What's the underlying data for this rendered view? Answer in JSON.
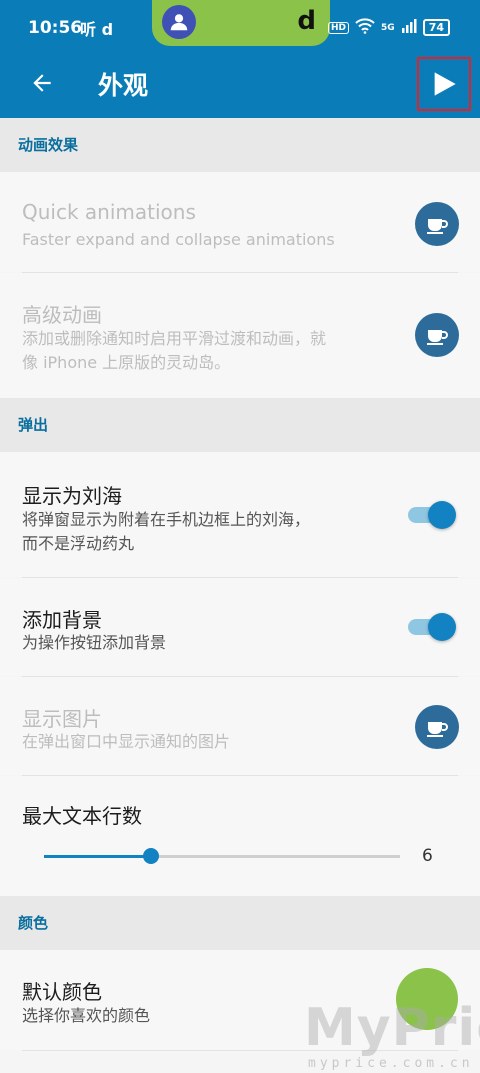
{
  "status_bar": {
    "time": "10:56",
    "left_icons": "听 d",
    "island_app_icon": "d",
    "hd_badge": "HD",
    "signal": "5G",
    "battery": "74"
  },
  "toolbar": {
    "title": "外观",
    "back_icon": "arrow-left-icon",
    "play_icon": "play-icon"
  },
  "sections": {
    "animation": {
      "header": "动画效果",
      "quick": {
        "title": "Quick animations",
        "subtitle": "Faster expand and collapse animations"
      },
      "advanced": {
        "title": "高级动画",
        "subtitle_line1": "添加或删除通知时启用平滑过渡和动画，就",
        "subtitle_line2": "像 iPhone 上原版的灵动岛。"
      }
    },
    "popup": {
      "header": "弹出",
      "notch": {
        "title": "显示为刘海",
        "subtitle_line1": "将弹窗显示为附着在手机边框上的刘海，",
        "subtitle_line2": "而不是浮动药丸",
        "enabled": true
      },
      "background": {
        "title": "添加背景",
        "subtitle": "为操作按钮添加背景",
        "enabled": true
      },
      "show_image": {
        "title": "显示图片",
        "subtitle": "在弹出窗口中显示通知的图片"
      },
      "max_lines": {
        "title": "最大文本行数",
        "value": "6",
        "fraction": 0.3
      }
    },
    "color": {
      "header": "颜色",
      "default_color": {
        "title": "默认颜色",
        "subtitle": "选择你喜欢的颜色",
        "swatch": "#8bc34a"
      }
    }
  },
  "colors": {
    "accent": "#0a7db8",
    "switch_on": "#1382c2",
    "premium_icon": "#2d6b9a"
  },
  "watermark": {
    "main": "MyPrice",
    "sub": "myprice.com.cn"
  }
}
